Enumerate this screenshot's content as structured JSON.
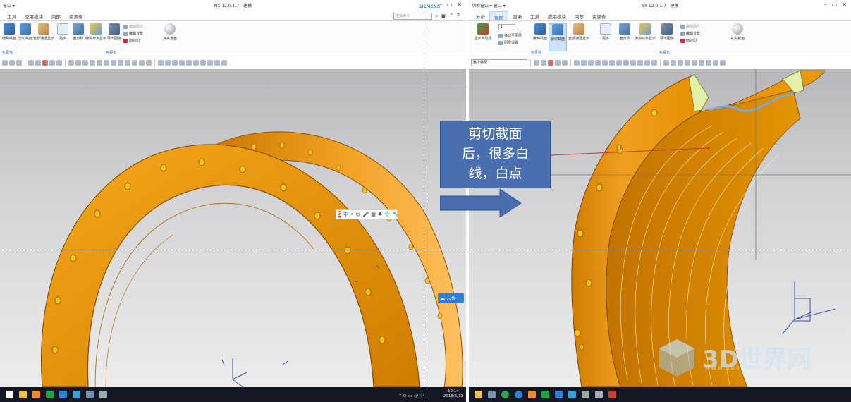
{
  "left_window": {
    "quick_access": "窗口 ▾",
    "title": "NX 12.0.1.7 - 建模",
    "brand": "SIEMENS",
    "menu": [
      "工具",
      "应用模块",
      "内部",
      "资源条"
    ],
    "search_placeholder": "查找命令",
    "ribbon": {
      "buttons": [
        "编辑截面",
        "剪切截面",
        "全部通透显示",
        "更多",
        "面分析",
        "编辑对象显示",
        "导出图像",
        "真实着色"
      ],
      "small_items": [
        "编辑图片...",
        "编辑背景",
        "面的边"
      ],
      "groups": [
        "可见性",
        "可视化"
      ]
    },
    "float_toolbar_icons": [
      "S",
      "中",
      "•",
      "☺",
      "🎤",
      "▦",
      "♣",
      "👕",
      "🔧"
    ],
    "cloud_button": "云盘",
    "taskbar": {
      "time": "19:14",
      "date": "2018/6/13",
      "ime": "中",
      "tray": "^ ⊙ ▭ ◁) 中"
    },
    "icons": [
      "windows-start-icon",
      "explorer-icon",
      "folder-icon",
      "app-icon",
      "app-icon",
      "nx-icon",
      "app-icon",
      "app-icon"
    ]
  },
  "right_window": {
    "quick_access": "切换窗口 ▾ 窗口 ▾",
    "title": "NX 12.0.1.7 - 建模",
    "menu": [
      "分析",
      "视图",
      "渲染",
      "工具",
      "应用模块",
      "内部",
      "资源条"
    ],
    "active_menu": "视图",
    "ribbon": {
      "buttons": [
        "显示和隐藏",
        "编辑截面",
        "剪切截面",
        "全部通透显示",
        "更多",
        "面分析",
        "编辑对象显示",
        "导出图像",
        "真实着色"
      ],
      "small_items": [
        "移动至图层",
        "图层设置",
        "编辑背景",
        "面的边"
      ],
      "dropdown_value": "1",
      "groups": [
        "可见性",
        "可视化"
      ]
    },
    "filter_select": "整个装配"
  },
  "callout": {
    "text_lines": [
      "剪切截面",
      "后，很多白",
      "线，白点"
    ]
  },
  "watermark": {
    "text": "3D世界网",
    "url": "WWW.3DSJW.COM"
  },
  "colors": {
    "part_orange": "#e89000",
    "callout_blue": "#4a6fb0",
    "leader_red": "#c0392b",
    "taskbar": "#141824"
  }
}
